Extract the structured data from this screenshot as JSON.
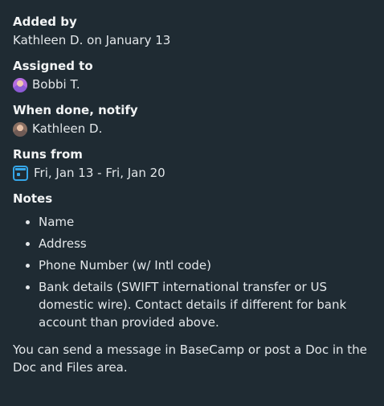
{
  "added_by": {
    "label": "Added by",
    "value": "Kathleen D. on January 13"
  },
  "assigned_to": {
    "label": "Assigned to",
    "person": "Bobbi T."
  },
  "notify": {
    "label": "When done, notify",
    "person": "Kathleen D."
  },
  "runs_from": {
    "label": "Runs from",
    "value": "Fri, Jan 13 - Fri, Jan 20"
  },
  "notes": {
    "label": "Notes",
    "items": [
      "Name",
      "Address",
      "Phone Number (w/ Intl code)",
      "Bank details (SWIFT international transfer or US domestic wire). Contact details if different for bank account than provided above."
    ],
    "footer": "You can send a message in BaseCamp or post a Doc in the Doc and Files area."
  },
  "colors": {
    "background": "#1f2b33",
    "calendar_accent": "#36a6e8"
  }
}
